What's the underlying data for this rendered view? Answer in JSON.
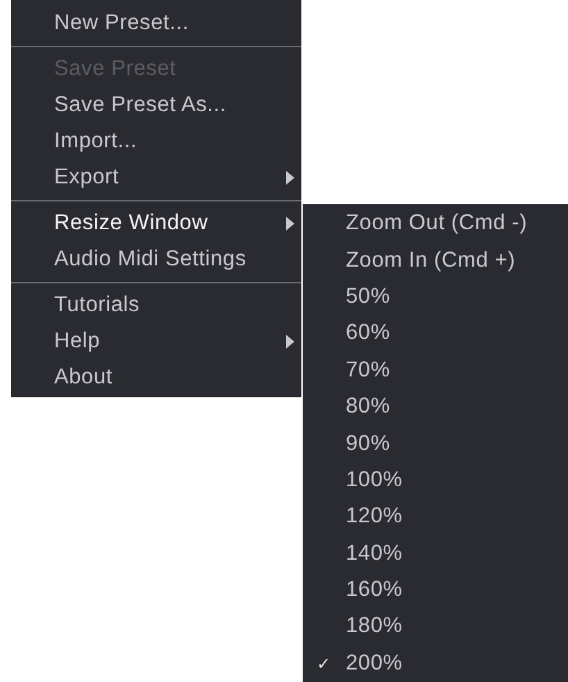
{
  "menu": {
    "items": [
      {
        "label": "New Preset...",
        "disabled": false,
        "selected": false,
        "submenu": false,
        "separator_after": true
      },
      {
        "label": "Save Preset",
        "disabled": true,
        "selected": false,
        "submenu": false,
        "separator_after": false
      },
      {
        "label": "Save Preset As...",
        "disabled": false,
        "selected": false,
        "submenu": false,
        "separator_after": false
      },
      {
        "label": "Import...",
        "disabled": false,
        "selected": false,
        "submenu": false,
        "separator_after": false
      },
      {
        "label": "Export",
        "disabled": false,
        "selected": false,
        "submenu": true,
        "separator_after": true
      },
      {
        "label": "Resize Window",
        "disabled": false,
        "selected": true,
        "submenu": true,
        "separator_after": false
      },
      {
        "label": "Audio Midi Settings",
        "disabled": false,
        "selected": false,
        "submenu": false,
        "separator_after": true
      },
      {
        "label": "Tutorials",
        "disabled": false,
        "selected": false,
        "submenu": false,
        "separator_after": false
      },
      {
        "label": "Help",
        "disabled": false,
        "selected": false,
        "submenu": true,
        "separator_after": false
      },
      {
        "label": "About",
        "disabled": false,
        "selected": false,
        "submenu": false,
        "separator_after": false
      }
    ]
  },
  "submenu": {
    "check_mark": "✓",
    "items": [
      {
        "label": "Zoom Out (Cmd -)",
        "checked": false
      },
      {
        "label": "Zoom In (Cmd +)",
        "checked": false
      },
      {
        "label": "50%",
        "checked": false
      },
      {
        "label": "60%",
        "checked": false
      },
      {
        "label": "70%",
        "checked": false
      },
      {
        "label": "80%",
        "checked": false
      },
      {
        "label": "90%",
        "checked": false
      },
      {
        "label": "100%",
        "checked": false
      },
      {
        "label": "120%",
        "checked": false
      },
      {
        "label": "140%",
        "checked": false
      },
      {
        "label": "160%",
        "checked": false
      },
      {
        "label": "180%",
        "checked": false
      },
      {
        "label": "200%",
        "checked": true
      }
    ]
  }
}
